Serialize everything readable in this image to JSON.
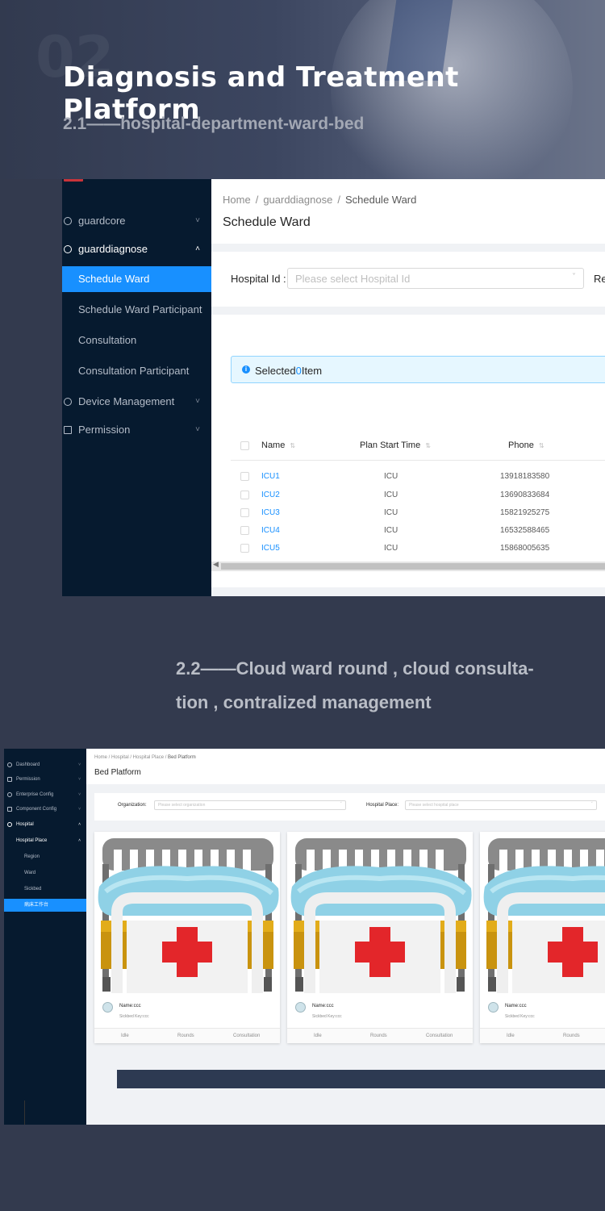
{
  "hero": {
    "bg_number": "02",
    "title": "Diagnosis and Treatment Platform",
    "subtitle": "2.1——hospital-department-ward-bed"
  },
  "screen1": {
    "sidebar": {
      "items": [
        {
          "label": "guardcore",
          "icon": "circle-icon",
          "chevron": "˅"
        },
        {
          "label": "guarddiagnose",
          "icon": "circle-icon",
          "chevron": "˄"
        },
        {
          "label": "Device Management",
          "icon": "circle-icon",
          "chevron": "˅"
        },
        {
          "label": "Permission",
          "icon": "square-icon",
          "chevron": "˅"
        }
      ],
      "subitems": [
        "Schedule Ward",
        "Schedule Ward Participant",
        "Consultation",
        "Consultation Participant"
      ]
    },
    "breadcrumb": [
      "Home",
      "guarddiagnose",
      "Schedule Ward"
    ],
    "breadcrumb_sep": "/",
    "page_title": "Schedule Ward",
    "filter": {
      "label": "Hospital Id :",
      "placeholder": "Please select Hospital Id",
      "next_label": "Re"
    },
    "alert": {
      "prefix": "Selected",
      "count": "0",
      "suffix": "Item"
    },
    "columns": [
      "Name",
      "Plan Start Time",
      "Phone"
    ],
    "rows": [
      {
        "name": "ICU1",
        "plan": "ICU",
        "phone": "13918183580"
      },
      {
        "name": "ICU2",
        "plan": "ICU",
        "phone": "13690833684"
      },
      {
        "name": "ICU3",
        "plan": "ICU",
        "phone": "15821925275"
      },
      {
        "name": "ICU4",
        "plan": "ICU",
        "phone": "16532588465"
      },
      {
        "name": "ICU5",
        "plan": "ICU",
        "phone": "15868005635"
      }
    ]
  },
  "section2": {
    "heading_line1": "2.2——Cloud ward round , cloud consulta-",
    "heading_line2": "tion , contralized management"
  },
  "screen2": {
    "sidebar": {
      "items": [
        {
          "label": "Dashboard",
          "chevron": "˅"
        },
        {
          "label": "Permission",
          "chevron": "˅"
        },
        {
          "label": "Enterprise Config",
          "chevron": "˅"
        },
        {
          "label": "Component Config",
          "chevron": "˅"
        },
        {
          "label": "Hospital",
          "chevron": "˄"
        }
      ],
      "group": {
        "label": "Hospital Place",
        "chevron": "˄"
      },
      "subitems": [
        "Region",
        "Ward",
        "Sickbed",
        "病床工作台"
      ]
    },
    "breadcrumb": "Home / Hospital / Hospital Place / ",
    "breadcrumb_current": "Bed Platform",
    "page_title": "Bed Platform",
    "filter": {
      "org_label": "Organization:",
      "org_placeholder": "Please select organization",
      "place_label": "Hospital Place:",
      "place_placeholder": "Please select hospital place"
    },
    "cards": [
      {
        "name": "Name:ccc",
        "key": "Sickbed Key:ccc",
        "actions": [
          "Idle",
          "Rounds",
          "Consultation"
        ]
      },
      {
        "name": "Name:ccc",
        "key": "Sickbed Key:ccc",
        "actions": [
          "Idle",
          "Rounds",
          "Consultation"
        ]
      },
      {
        "name": "Name:ccc",
        "key": "Sickbed Key:ccc",
        "actions": [
          "Idle",
          "Rounds"
        ]
      }
    ]
  },
  "colors": {
    "accent": "#1890ff",
    "sidebar": "#061a2f",
    "page_bg": "#333a4e",
    "cross": "#e3262a"
  }
}
